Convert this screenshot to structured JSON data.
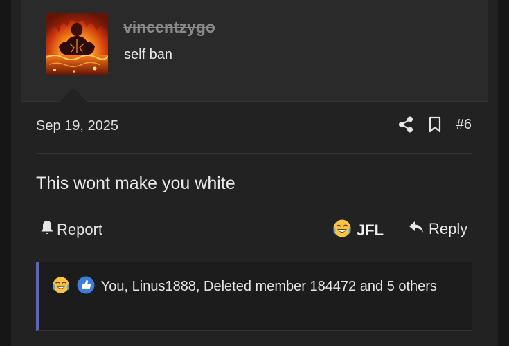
{
  "user": {
    "username": "vincentzygo",
    "title": "self ban",
    "avatar_desc": "avatar-fire-figure"
  },
  "post": {
    "date": "Sep 19, 2025",
    "number": "#6",
    "body": "This wont make you white"
  },
  "actions": {
    "share_icon": "share-icon",
    "bookmark_icon": "bookmark-icon",
    "report_label": "Report",
    "report_icon": "bell-icon",
    "jfl_label": "JFL",
    "jfl_icon": "crying-laughing-emoji-icon",
    "reply_label": "Reply",
    "reply_icon": "reply-arrow-icon"
  },
  "reactions": {
    "icons": [
      "crying-laughing-emoji-icon",
      "thumbs-up-icon"
    ],
    "summary": "You, Linus1888, Deleted member 184472 and 5 others",
    "accent_color": "#5b63c6"
  },
  "colors": {
    "background": "#161616",
    "post_bg": "#222222",
    "user_card_bg": "#2a2a2a",
    "username_color": "#8a8a8a"
  }
}
